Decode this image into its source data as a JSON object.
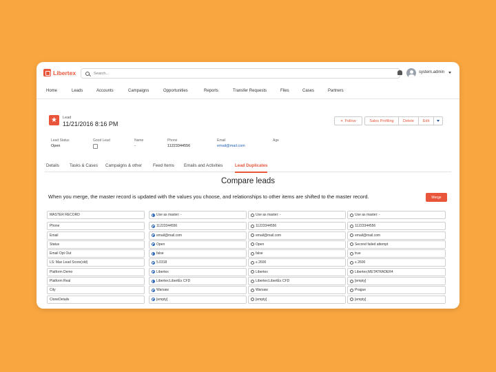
{
  "app": {
    "logo": "Libertex"
  },
  "search": {
    "placeholder": "Search..."
  },
  "user": {
    "name": "system.admin"
  },
  "nav": [
    "Home",
    "Leads",
    "Accounts",
    "Campaigns",
    "Opportunities",
    "Reports",
    "Transfer Requests",
    "Files",
    "Cases",
    "Partners"
  ],
  "record": {
    "type_label": "Lead",
    "title": "11/21/2016 8:16 PM"
  },
  "actions": {
    "follow": "Follow",
    "sales_profiling": "Sales Profiling",
    "delete": "Delete",
    "edit": "Edit"
  },
  "fields": {
    "lead_status": {
      "label": "Lead Status",
      "value": "Open"
    },
    "good_lead": {
      "label": "Good Lead"
    },
    "name": {
      "label": "Name",
      "value": "-"
    },
    "phone": {
      "label": "Phone",
      "value": "11223344556"
    },
    "email": {
      "label": "Email",
      "value": "email@mail.com"
    },
    "age": {
      "label": "Age"
    }
  },
  "tabs": [
    "Details",
    "Tasks & Cases",
    "Campaigns & other",
    "Feed Items",
    "Emails and Activities",
    "Lead Duplicates"
  ],
  "compare": {
    "title": "Compare leads",
    "description": "When you merge, the master record is updated with the values you choose, and relationships to other items are shifted to the master record.",
    "merge_label": "Merge",
    "rows": [
      {
        "label": "MASTER RECORD",
        "values": [
          "Use as master: -",
          "Use as master: -",
          "Use as master: -"
        ],
        "selected": 0
      },
      {
        "label": "Phone",
        "values": [
          "11223344556",
          "11223344556",
          "11223344556"
        ],
        "selected": 0
      },
      {
        "label": "Email",
        "values": [
          "email@mail.com",
          "email@mail.com",
          "email@mail.com"
        ],
        "selected": 0
      },
      {
        "label": "Status",
        "values": [
          "Open",
          "Open",
          "Second failed attempt"
        ],
        "selected": 0
      },
      {
        "label": "Email Opt Out",
        "values": [
          "false",
          "false",
          "true"
        ],
        "selected": 0
      },
      {
        "label": "LS: Max Lead Score(old)",
        "values": [
          "5.0318",
          "≤ 2600",
          "≤ 2600"
        ],
        "selected": 0
      },
      {
        "label": "Platform Demo",
        "values": [
          "Libertex",
          "Libertex",
          "Libertex;METATRADER4"
        ],
        "selected": 0
      },
      {
        "label": "Platform Real",
        "values": [
          "Libertex;LibertEx CFD",
          "Libertex;LibertEx CFD",
          "[empty]"
        ],
        "selected": 0
      },
      {
        "label": "City",
        "values": [
          "Warsaw",
          "Warsaw",
          "Prague"
        ],
        "selected": 0
      },
      {
        "label": "CloneDetails",
        "values": [
          "[empty]",
          "[empty]",
          "[empty]"
        ],
        "selected": 0
      }
    ]
  },
  "colors": {
    "background": "#f9a640",
    "accent": "#e8553a",
    "link": "#1f5fb4"
  }
}
